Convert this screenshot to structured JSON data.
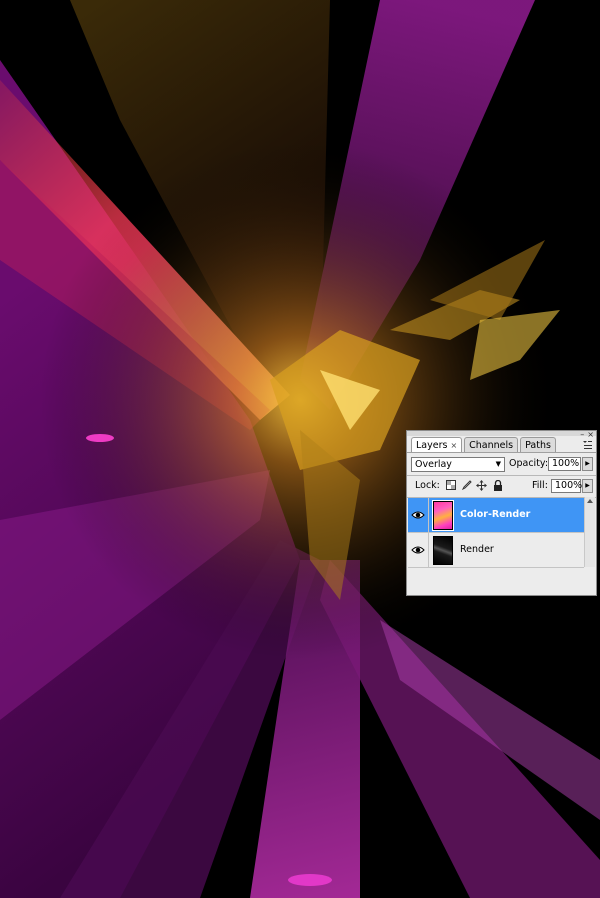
{
  "canvas": {
    "description_colors": {
      "magenta": "#c020b0",
      "purple": "#6a0c6e",
      "pink": "#ff3070",
      "orange": "#ff7a3a",
      "gold": "#e0a020",
      "black": "#000000"
    }
  },
  "layers_panel": {
    "tabs": [
      {
        "label": "Layers",
        "close": "×",
        "active": true
      },
      {
        "label": "Channels",
        "active": false
      },
      {
        "label": "Paths",
        "active": false
      }
    ],
    "window_buttons": {
      "minimize": "–",
      "close": "×"
    },
    "menu_icon": "panel-menu-icon",
    "blend_mode": "Overlay",
    "opacity_label": "Opacity:",
    "opacity_value": "100%",
    "lock_label": "Lock:",
    "fill_label": "Fill:",
    "fill_value": "100%",
    "lock_icons": [
      "lock-transparent-icon",
      "lock-paint-icon",
      "lock-move-icon",
      "lock-all-icon"
    ],
    "layers": [
      {
        "name": "Color-Render",
        "selected": true,
        "visible": true,
        "thumb_icon": "gradient-thumbnail"
      },
      {
        "name": "Render",
        "selected": false,
        "visible": true,
        "thumb_icon": "render-thumbnail"
      }
    ],
    "accent_color": "#3f95f5"
  }
}
